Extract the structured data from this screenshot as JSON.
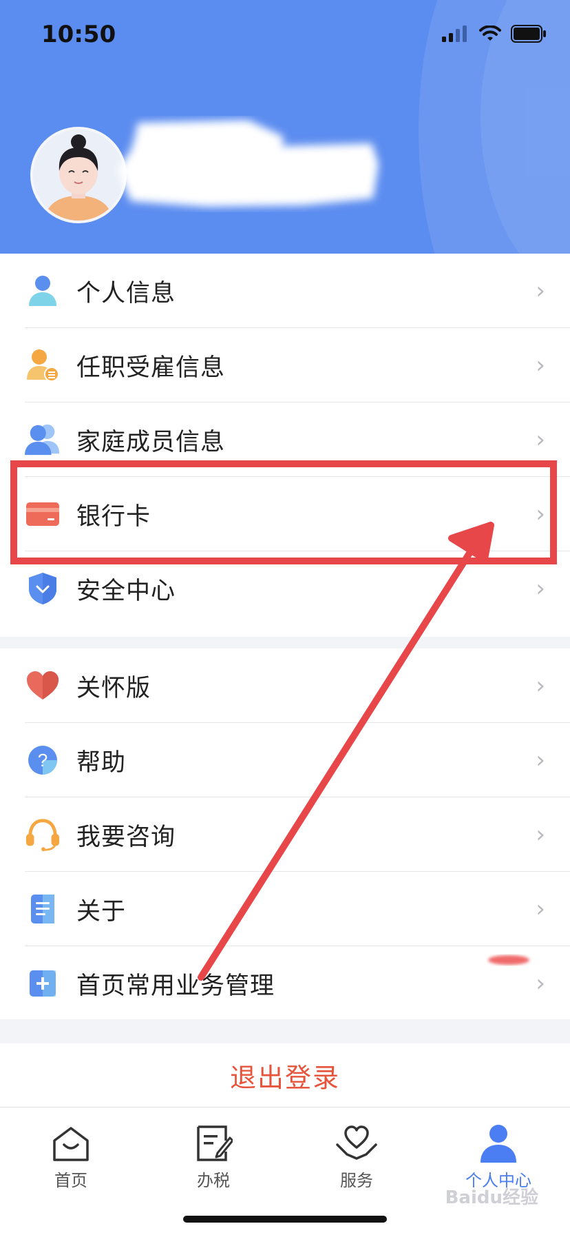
{
  "status_bar": {
    "time": "10:50"
  },
  "menu_group_1": [
    {
      "label": "个人信息",
      "icon": "person-icon"
    },
    {
      "label": "任职受雇信息",
      "icon": "employment-icon"
    },
    {
      "label": "家庭成员信息",
      "icon": "family-icon"
    },
    {
      "label": "银行卡",
      "icon": "bank-card-icon"
    },
    {
      "label": "安全中心",
      "icon": "shield-icon"
    }
  ],
  "menu_group_2": [
    {
      "label": "关怀版",
      "icon": "heart-icon"
    },
    {
      "label": "帮助",
      "icon": "help-icon"
    },
    {
      "label": "我要咨询",
      "icon": "headset-icon"
    },
    {
      "label": "关于",
      "icon": "document-icon"
    },
    {
      "label": "首页常用业务管理",
      "icon": "plus-square-icon"
    }
  ],
  "logout_label": "退出登录",
  "tabbar": [
    {
      "label": "首页",
      "icon": "home-icon",
      "active": false
    },
    {
      "label": "办税",
      "icon": "tax-form-icon",
      "active": false
    },
    {
      "label": "服务",
      "icon": "service-heart-icon",
      "active": false
    },
    {
      "label": "个人中心",
      "icon": "personal-center-icon",
      "active": true
    }
  ],
  "watermark": "Baidu经验",
  "colors": {
    "header": "#5b8cef",
    "accent": "#4a7ef2",
    "logout": "#e6543c",
    "annotation": "#e8474a"
  }
}
